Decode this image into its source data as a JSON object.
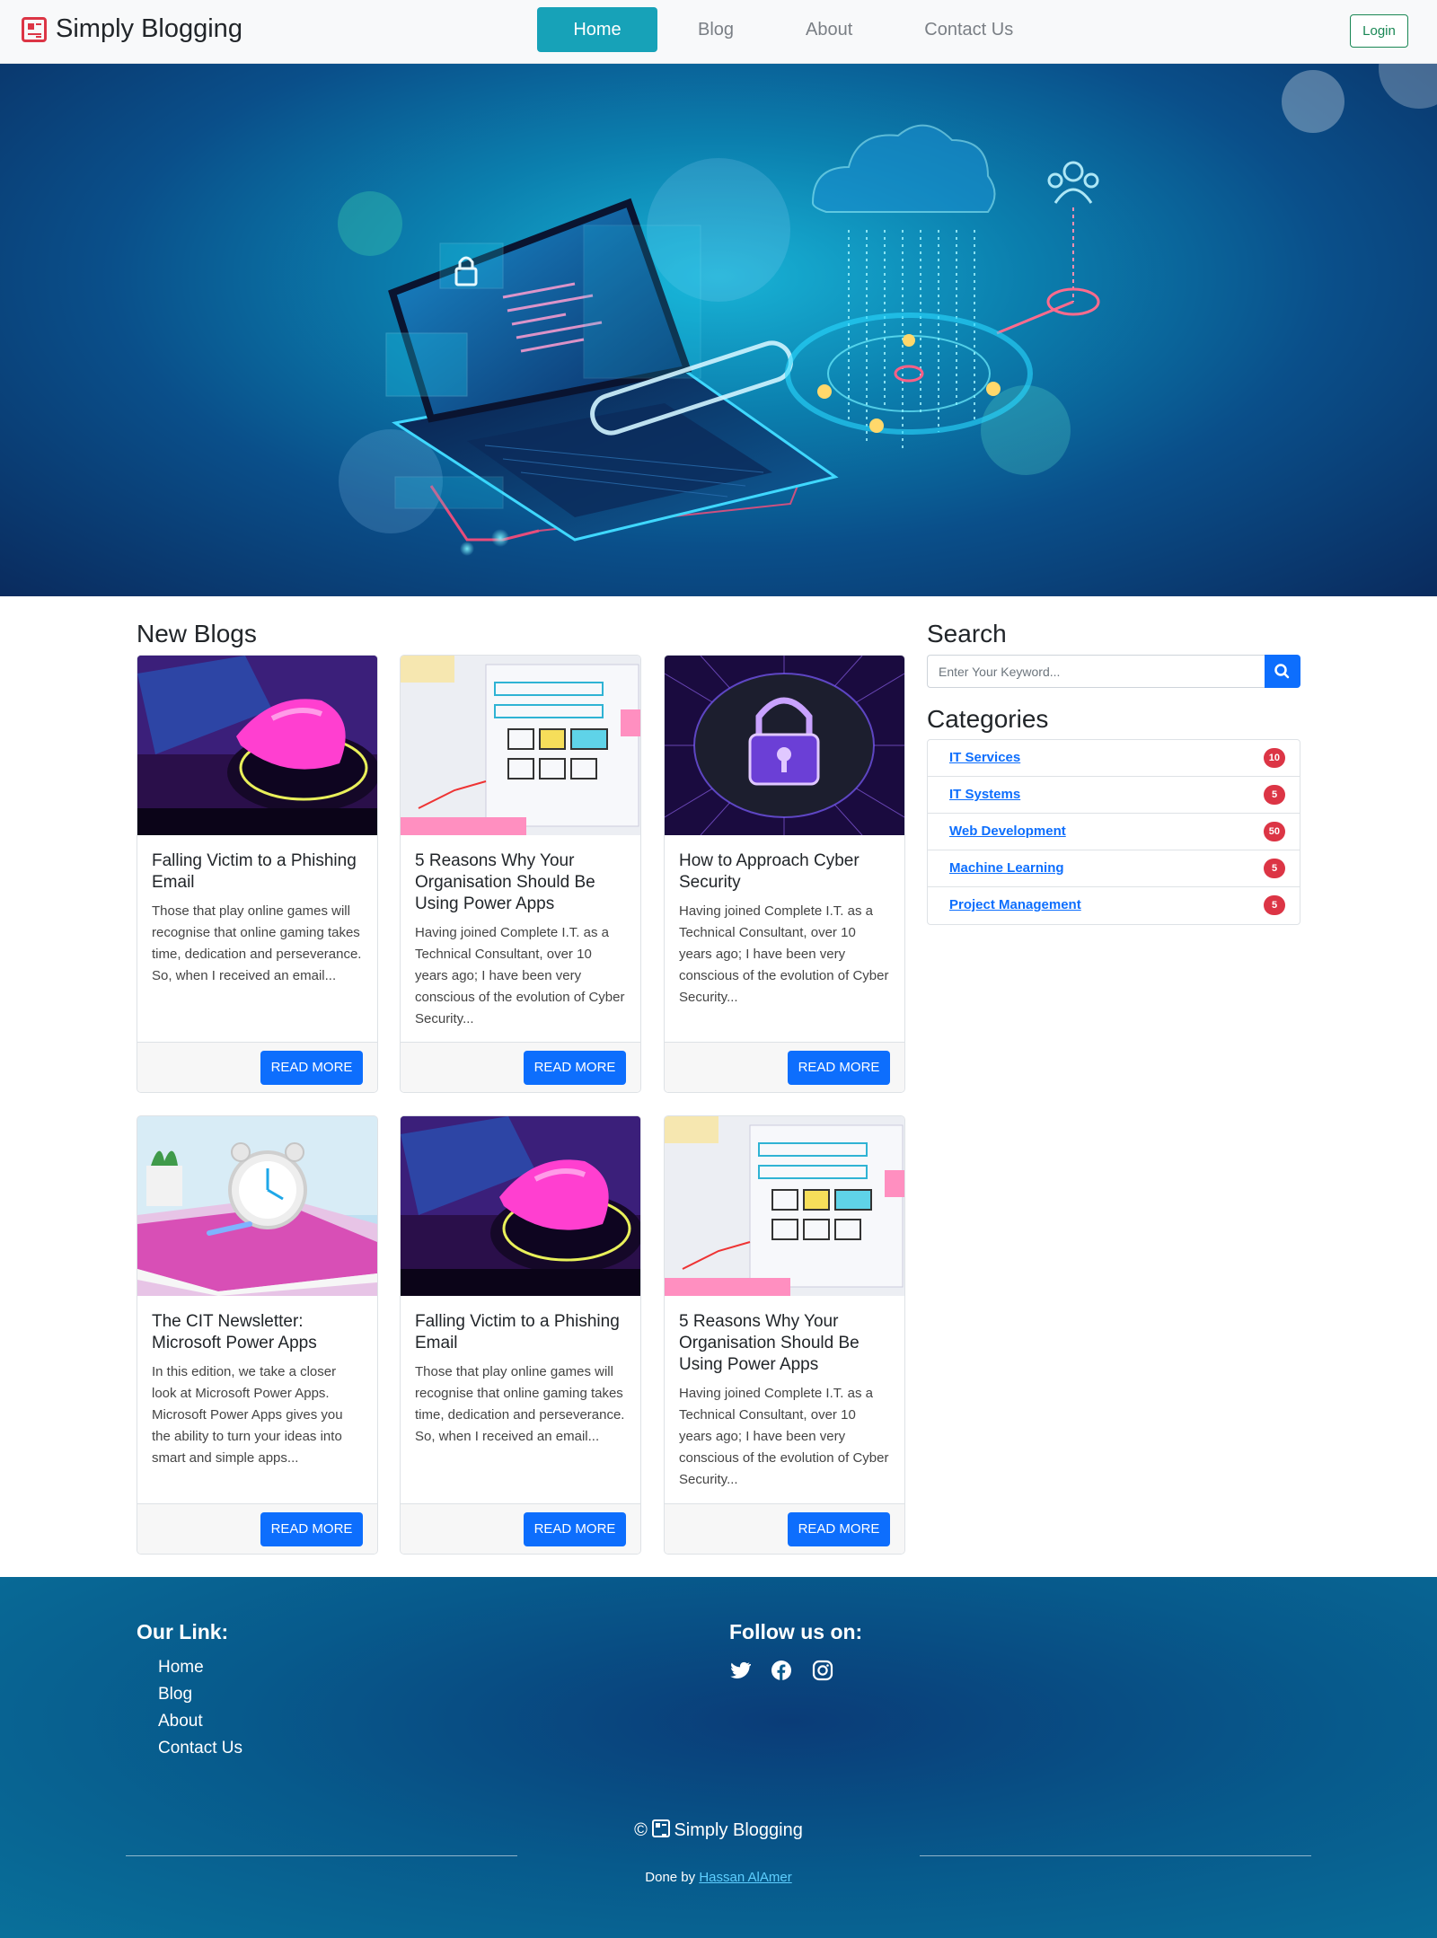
{
  "navbar": {
    "brand": "Simply Blogging",
    "links": [
      "Home",
      "Blog",
      "About",
      "Contact Us"
    ],
    "active": "Home",
    "login": "Login"
  },
  "main": {
    "section_title": "New Blogs",
    "posts": [
      {
        "title": "Falling Victim to a Phishing Email",
        "excerpt": "Those that play online games will recognise that online gaming takes time, dedication and perseverance. So, when I received an email...",
        "button": "READ MORE",
        "image": "gaming-mouse"
      },
      {
        "title": "5 Reasons Why Your Organisation Should Be Using Power Apps",
        "excerpt": "Having joined Complete I.T. as a Technical Consultant, over 10 years ago; I have been very conscious of the evolution of Cyber Security...",
        "button": "READ MORE",
        "image": "wireframe-sketch"
      },
      {
        "title": "How to Approach Cyber Security",
        "excerpt": "Having joined Complete I.T. as a Technical Consultant, over 10 years ago; I have been very conscious of the evolution of Cyber Security...",
        "button": "READ MORE",
        "image": "circuit-lock"
      },
      {
        "title": "The CIT Newsletter: Microsoft Power Apps",
        "excerpt": "In this edition, we take a closer look at Microsoft Power Apps. Microsoft Power Apps gives you the ability to turn your ideas into smart and simple apps...",
        "button": "READ MORE",
        "image": "alarm-clock"
      },
      {
        "title": "Falling Victim to a Phishing Email",
        "excerpt": "Those that play online games will recognise that online gaming takes time, dedication and perseverance. So, when I received an email...",
        "button": "READ MORE",
        "image": "gaming-mouse"
      },
      {
        "title": "5 Reasons Why Your Organisation Should Be Using Power Apps",
        "excerpt": "Having joined Complete I.T. as a Technical Consultant, over 10 years ago; I have been very conscious of the evolution of Cyber Security...",
        "button": "READ MORE",
        "image": "wireframe-sketch"
      }
    ]
  },
  "sidebar": {
    "search_title": "Search",
    "search_placeholder": "Enter Your Keyword...",
    "categories_title": "Categories",
    "categories": [
      {
        "name": "IT Services",
        "count": "10"
      },
      {
        "name": "IT Systems",
        "count": "5"
      },
      {
        "name": "Web Development",
        "count": "50"
      },
      {
        "name": "Machine Learning",
        "count": "5"
      },
      {
        "name": "Project Management",
        "count": "5"
      }
    ]
  },
  "footer": {
    "links_title": "Our Link:",
    "links": [
      "Home",
      "Blog",
      "About",
      "Contact Us"
    ],
    "follow_title": "Follow us on:",
    "social": [
      "twitter-icon",
      "facebook-icon",
      "instagram-icon"
    ],
    "copyright_symbol": "©",
    "copyright_brand": "Simply Blogging",
    "done_by": "Done by",
    "author": "Hassan AlAmer"
  },
  "colors": {
    "accent": "#17a2b8",
    "primary": "#0d6efd",
    "badge": "#dc3545",
    "login": "#198754"
  }
}
